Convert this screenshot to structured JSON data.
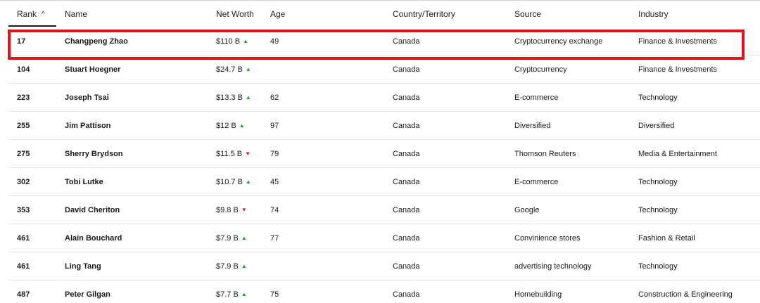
{
  "table": {
    "columns": {
      "rank": "Rank",
      "name": "Name",
      "net_worth": "Net Worth",
      "age": "Age",
      "country": "Country/Territory",
      "source": "Source",
      "industry": "Industry"
    },
    "sort_icon": "^",
    "rows": [
      {
        "rank": "17",
        "name": "Changpeng Zhao",
        "net_worth": "$110 B",
        "trend": "up",
        "trend_glyph": "▲",
        "age": "49",
        "country": "Canada",
        "source": "Cryptocurrency exchange",
        "industry": "Finance & Investments"
      },
      {
        "rank": "104",
        "name": "Stuart Hoegner",
        "net_worth": "$24.7 B",
        "trend": "up",
        "trend_glyph": "▲",
        "age": "",
        "country": "Canada",
        "source": "Cryptocurrency",
        "industry": "Finance & Investments"
      },
      {
        "rank": "223",
        "name": "Joseph Tsai",
        "net_worth": "$13.3 B",
        "trend": "up",
        "trend_glyph": "▲",
        "age": "62",
        "country": "Canada",
        "source": "E-commerce",
        "industry": "Technology"
      },
      {
        "rank": "255",
        "name": "Jim Pattison",
        "net_worth": "$12 B",
        "trend": "up",
        "trend_glyph": "▲",
        "age": "97",
        "country": "Canada",
        "source": "Diversified",
        "industry": "Diversified"
      },
      {
        "rank": "275",
        "name": "Sherry Brydson",
        "net_worth": "$11.5 B",
        "trend": "down",
        "trend_glyph": "▼",
        "age": "79",
        "country": "Canada",
        "source": "Thomson Reuters",
        "industry": "Media & Entertainment"
      },
      {
        "rank": "302",
        "name": "Tobi Lutke",
        "net_worth": "$10.7 B",
        "trend": "up",
        "trend_glyph": "▲",
        "age": "45",
        "country": "Canada",
        "source": "E-commerce",
        "industry": "Technology"
      },
      {
        "rank": "353",
        "name": "David Cheriton",
        "net_worth": "$9.8 B",
        "trend": "down",
        "trend_glyph": "▼",
        "age": "74",
        "country": "Canada",
        "source": "Google",
        "industry": "Technology"
      },
      {
        "rank": "461",
        "name": "Alain Bouchard",
        "net_worth": "$7.9 B",
        "trend": "up",
        "trend_glyph": "▲",
        "age": "77",
        "country": "Canada",
        "source": "Convinience stores",
        "industry": "Fashion & Retail"
      },
      {
        "rank": "461",
        "name": "Ling Tang",
        "net_worth": "$7.9 B",
        "trend": "up",
        "trend_glyph": "▲",
        "age": "",
        "country": "Canada",
        "source": "advertising technology",
        "industry": "Technology"
      },
      {
        "rank": "487",
        "name": "Peter Gilgan",
        "net_worth": "$7.7 B",
        "trend": "up",
        "trend_glyph": "▲",
        "age": "75",
        "country": "Canada",
        "source": "Homebuilding",
        "industry": "Construction & Engineering"
      }
    ]
  },
  "colors": {
    "trend_up": "#1a9a3a",
    "trend_down": "#d0202a",
    "highlight": "#e0121b"
  }
}
